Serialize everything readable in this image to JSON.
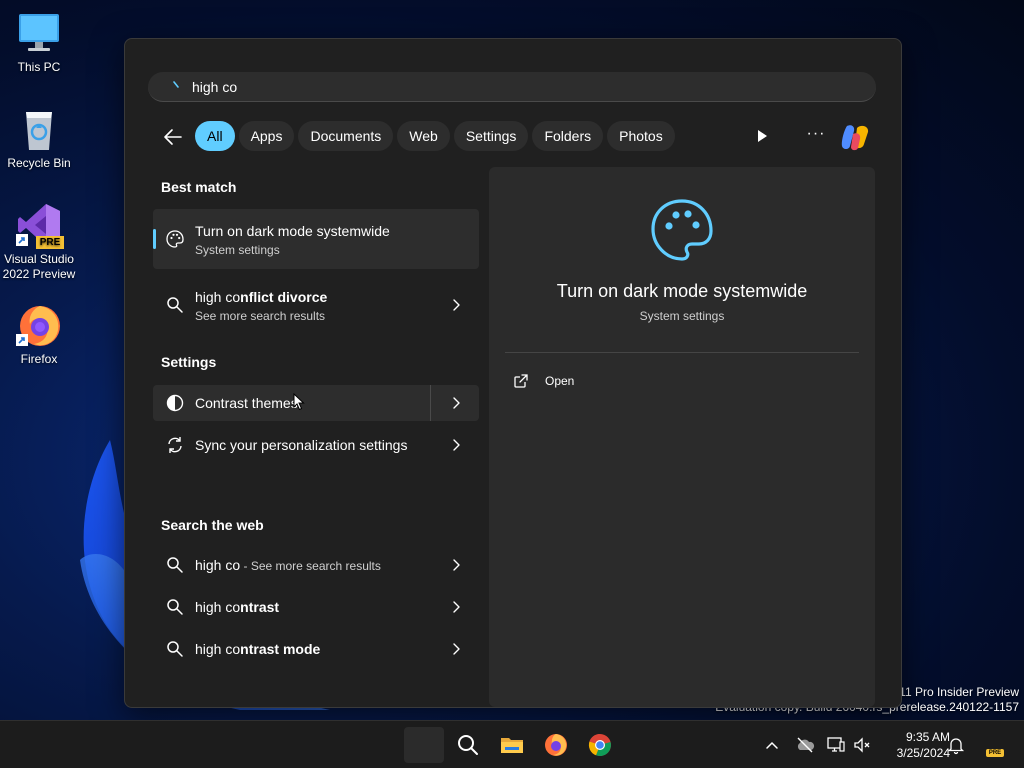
{
  "desktop": {
    "icons": [
      {
        "label": "This PC",
        "icon": "monitor-icon"
      },
      {
        "label": "Recycle Bin",
        "icon": "recycle-bin-icon"
      },
      {
        "label_line1": "Visual Studio",
        "label_line2": "2022 Preview",
        "badge": "PRE",
        "icon": "visual-studio-icon"
      },
      {
        "label": "Firefox",
        "icon": "firefox-icon"
      }
    ],
    "watermark": {
      "line1": "s 11 Pro Insider Preview",
      "line2": "Evaluation copy. Build 26040.rs_prerelease.240122-1157"
    }
  },
  "search": {
    "query": "high co",
    "filters": [
      {
        "label": "All",
        "active": true
      },
      {
        "label": "Apps"
      },
      {
        "label": "Documents"
      },
      {
        "label": "Web"
      },
      {
        "label": "Settings"
      },
      {
        "label": "Folders"
      },
      {
        "label": "Photos"
      }
    ]
  },
  "results": {
    "best_match_title": "Best match",
    "best_match": {
      "title": "Turn on dark mode systemwide",
      "subtitle": "System settings",
      "icon": "palette-icon"
    },
    "conflict": {
      "prefix": "high co",
      "rest": "nflict divorce",
      "subtitle": "See more search results",
      "icon": "search-icon"
    },
    "settings_title": "Settings",
    "settings": [
      {
        "label": "Contrast themes",
        "icon": "contrast-icon"
      },
      {
        "label": "Sync your personalization settings",
        "icon": "sync-icon"
      }
    ],
    "web_title": "Search the web",
    "web": [
      {
        "prefix": "high co",
        "rest": "",
        "suffix": " - See more search results"
      },
      {
        "prefix": "high co",
        "rest": "ntrast",
        "suffix": ""
      },
      {
        "prefix": "high co",
        "rest": "ntrast mode",
        "suffix": ""
      }
    ]
  },
  "preview": {
    "title": "Turn on dark mode systemwide",
    "subtitle": "System settings",
    "open_label": "Open"
  },
  "taskbar": {
    "time": "9:35 AM",
    "date": "3/25/2024",
    "pre_badge": "PRE"
  },
  "colors": {
    "accent": "#60cdff",
    "panel": "#202020",
    "card": "#2b2b2b"
  }
}
